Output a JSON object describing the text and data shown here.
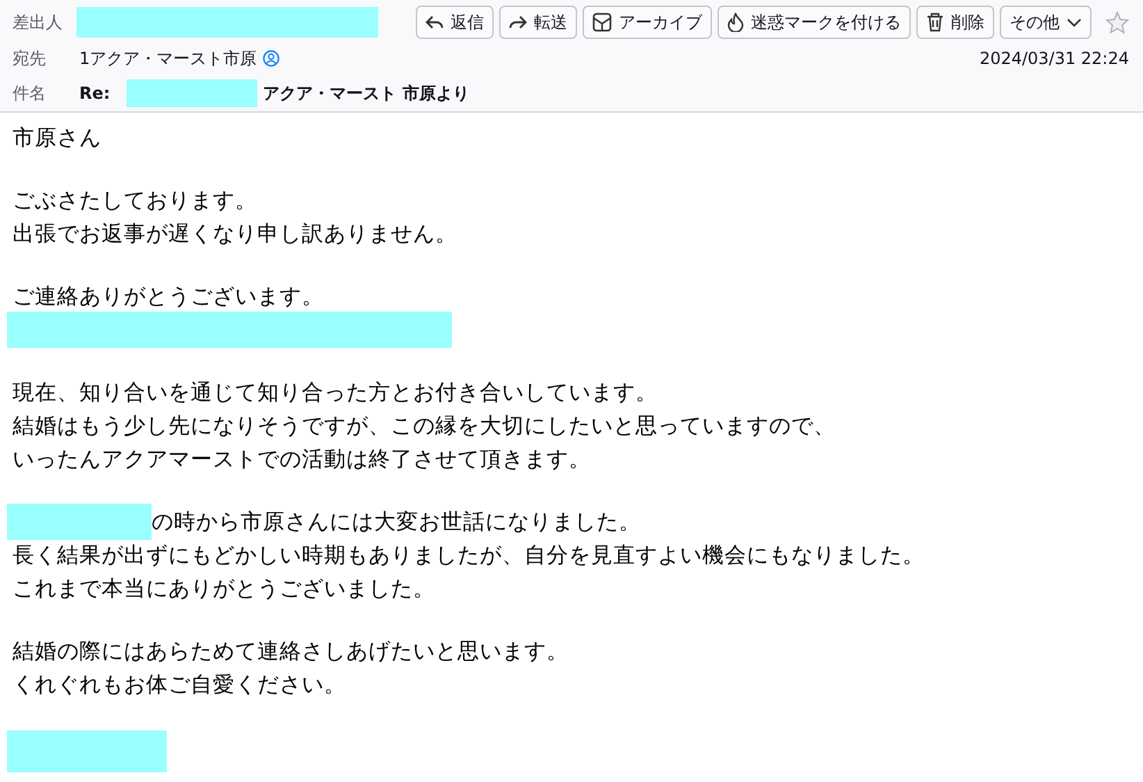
{
  "header": {
    "from": {
      "label": "差出人"
    },
    "toolbar": [
      {
        "kind": "reply",
        "label": "返信"
      },
      {
        "kind": "forward",
        "label": "転送"
      },
      {
        "kind": "archive",
        "label": "アーカイブ"
      },
      {
        "kind": "junk",
        "label": "迷惑マークを付ける"
      },
      {
        "kind": "delete",
        "label": "削除"
      },
      {
        "kind": "more",
        "label": "その他"
      }
    ],
    "starred": false,
    "to": {
      "label": "宛先",
      "value": "1アクア・マースト市原"
    },
    "date": "2024/03/31 22:24",
    "subject": {
      "label": "件名",
      "prefix": "Re:",
      "value": "アクア・マースト 市原より"
    }
  },
  "body": [
    {
      "lines": [
        {
          "kind": "text",
          "text": "市原さん"
        }
      ]
    },
    {
      "lines": [
        {
          "kind": "text",
          "text": "ごぶさたしております。"
        },
        {
          "kind": "text",
          "text": "出張でお返事が遅くなり申し訳ありません。"
        }
      ]
    },
    {
      "lines": [
        {
          "kind": "text",
          "text": "ご連絡ありがとうございます。"
        },
        {
          "kind": "redaction"
        }
      ]
    },
    {
      "lines": [
        {
          "kind": "text",
          "text": "現在、知り合いを通じて知り合った方とお付き合いしています。"
        },
        {
          "kind": "text",
          "text": "結婚はもう少し先になりそうですが、この縁を大切にしたいと思っていますので、"
        },
        {
          "kind": "text",
          "text": "いったんアクアマーストでの活動は終了させて頂きます。"
        }
      ]
    },
    {
      "lines": [
        {
          "kind": "redacted_prefix",
          "text": "の時から市原さんには大変お世話になりました。"
        },
        {
          "kind": "text",
          "text": "長く結果が出ずにもどかしい時期もありましたが、自分を見直すよい機会にもなりました。"
        },
        {
          "kind": "text",
          "text": "これまで本当にありがとうございました。"
        }
      ]
    },
    {
      "lines": [
        {
          "kind": "text",
          "text": "結婚の際にはあらためて連絡さしあげたいと思います。"
        },
        {
          "kind": "text",
          "text": "くれぐれもお体ご自愛ください。"
        }
      ]
    },
    {
      "lines": [
        {
          "kind": "signature_redaction"
        }
      ]
    }
  ]
}
